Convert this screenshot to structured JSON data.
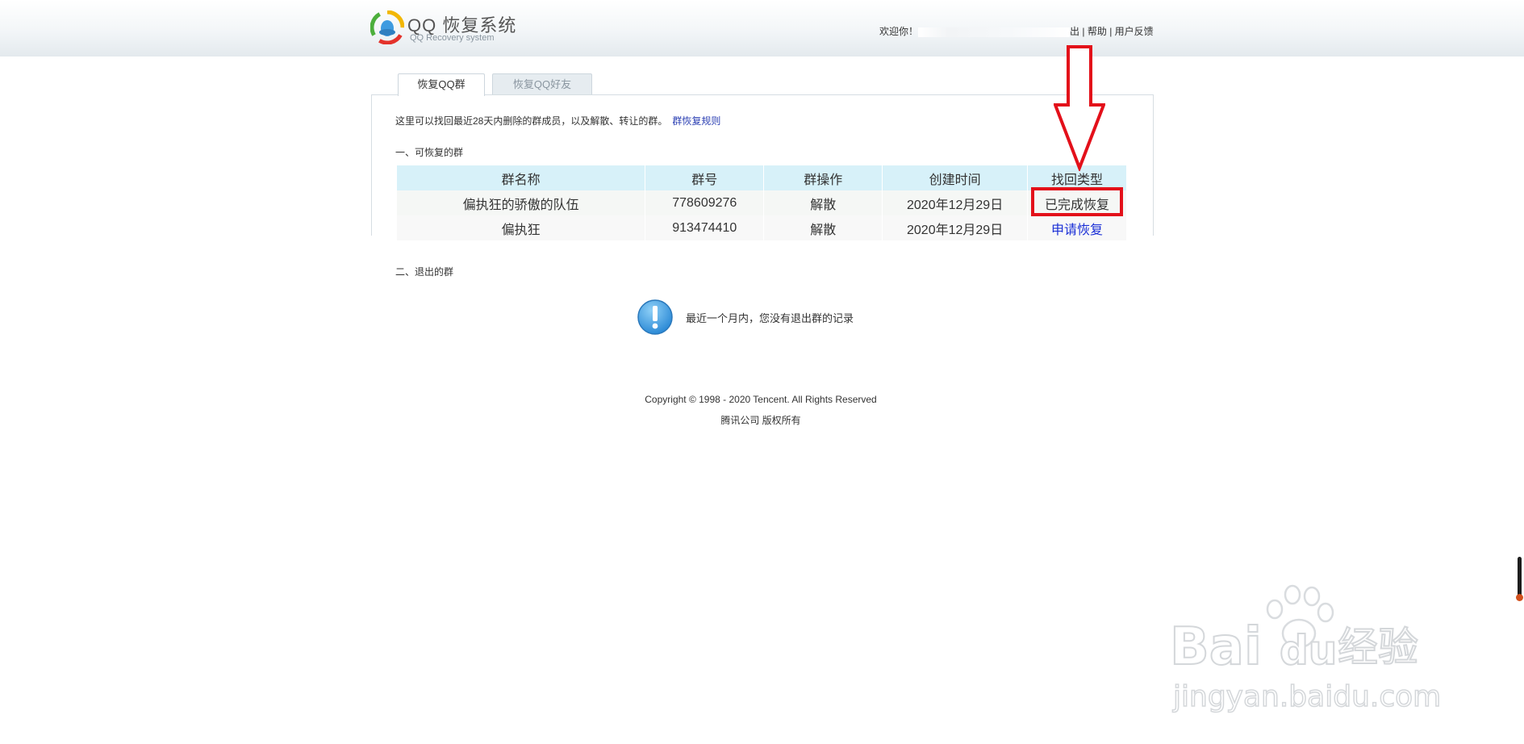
{
  "header": {
    "logo_title": "QQ 恢复系统",
    "logo_subtitle": "QQ Recovery system",
    "welcome": "欢迎你！",
    "logout_tail": "出",
    "help": "帮助",
    "feedback": "用户反馈",
    "separator": "|"
  },
  "tabs": [
    {
      "label": "恢复QQ群",
      "active": true
    },
    {
      "label": "恢复QQ好友",
      "active": false
    }
  ],
  "intro": {
    "text": "这里可以找回最近28天内删除的群成员，以及解散、转让的群。",
    "rule_link": "群恢复规则"
  },
  "section1": {
    "title": "一、可恢复的群",
    "columns": [
      "群名称",
      "群号",
      "群操作",
      "创建时间",
      "找回类型"
    ],
    "rows": [
      {
        "name": "偏执狂的骄傲的队伍",
        "number": "778609276",
        "operation": "解散",
        "created": "2020年12月29日",
        "type": "已完成恢复"
      },
      {
        "name": "偏执狂",
        "number": "913474410",
        "operation": "解散",
        "created": "2020年12月29日",
        "type": "申请恢复"
      }
    ]
  },
  "section2": {
    "title": "二、退出的群",
    "empty_message": "最近一个月内，您没有退出群的记录"
  },
  "footer": {
    "copyright": "Copyright © 1998 - 2020 Tencent. All Rights Reserved",
    "company": "腾讯公司 版权所有"
  },
  "watermark": {
    "brand": "Bai",
    "brand_du": "du",
    "brand_cn": "经验",
    "url": "jingyan.baidu.com"
  },
  "colors": {
    "table_header": "#d7f1f9",
    "link_blue": "#1a2fd6",
    "highlight_red": "#e3101a",
    "info_icon_blue": "#3a9ee0"
  },
  "icons": {
    "logo": "qq-recovery-logo-icon",
    "info": "exclamation-info-icon",
    "annotation": "red-down-arrow-icon"
  }
}
